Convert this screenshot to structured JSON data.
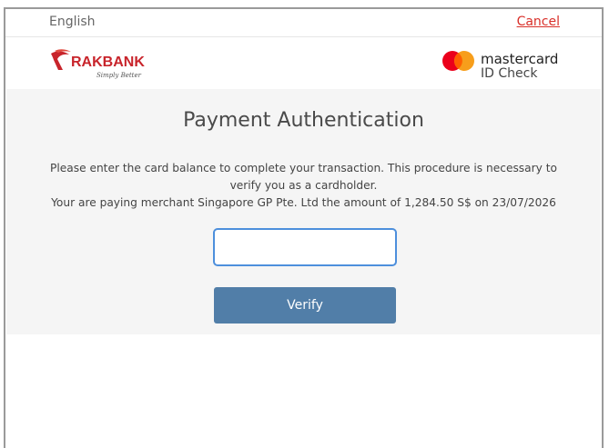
{
  "topbar": {
    "language": "English",
    "cancel_label": "Cancel"
  },
  "bank": {
    "name": "RAKBANK",
    "tagline": "Simply Better"
  },
  "scheme": {
    "name": "mastercard",
    "program": "ID Check"
  },
  "content": {
    "title": "Payment Authentication",
    "instruction": "Please enter the card balance to complete your transaction. This procedure is necessary to verify you as a cardholder.",
    "payment_info": "Your are paying merchant Singapore GP Pte. Ltd the amount of 1,284.50 S$ on 23/07/2026",
    "balance_input_value": "",
    "verify_label": "Verify"
  },
  "colors": {
    "cancel": "#d9302a",
    "bank_red": "#c8242b",
    "verify_button": "#517ea8",
    "input_border": "#4d8fdc",
    "mc_red": "#eb001b",
    "mc_orange": "#f79e1b"
  }
}
